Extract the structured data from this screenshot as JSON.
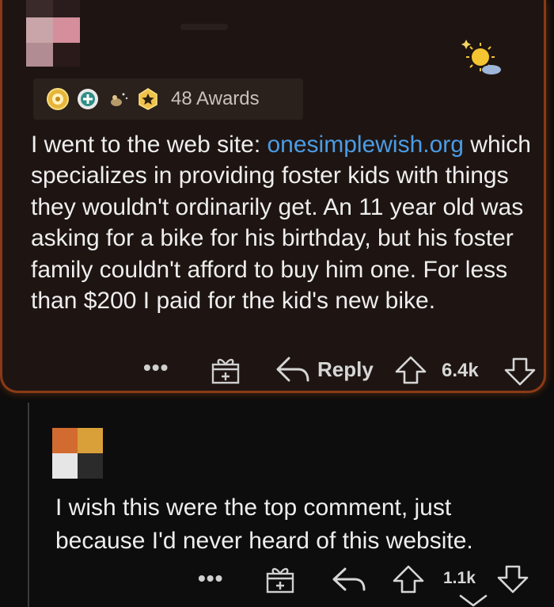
{
  "comment": {
    "awards_count": "48 Awards",
    "text_before_link": "I went to the web site: ",
    "link_text": "onesimplewish.org",
    "text_after_link": " which specializes in providing foster kids with things they wouldn't ordinarily get. An 11 year old was asking for a bike for his birthday, but his foster family couldn't afford to buy him one.  For less than $200 I paid for the kid's new bike.",
    "more_label": "•••",
    "reply_label": "Reply",
    "score": "6.4k",
    "award_icons": [
      "gold-coin-award-icon",
      "helpful-award-icon",
      "rocket-like-award-icon",
      "star-award-icon"
    ],
    "colors": {
      "card_background": "#1e1512",
      "card_border": "#8a3a16",
      "link": "#4b9ce5"
    }
  },
  "reply": {
    "text": "I wish this were the top comment, just because I'd never heard of this website.",
    "more_label": "•••",
    "score": "1.1k"
  }
}
